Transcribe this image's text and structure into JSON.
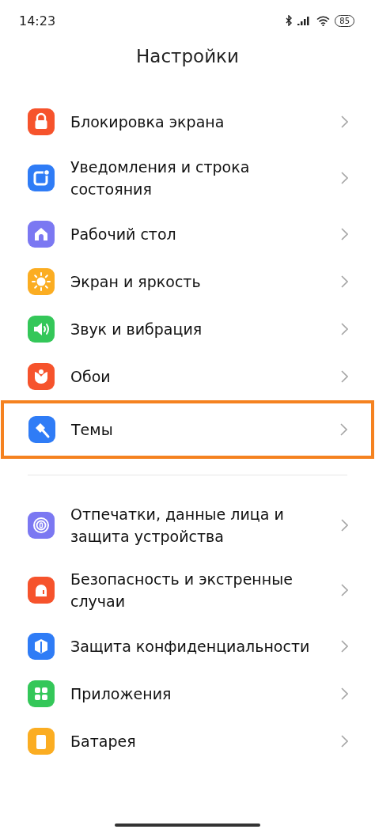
{
  "status_bar": {
    "time": "14:23",
    "battery": "85"
  },
  "title": "Настройки",
  "groups": [
    {
      "items": [
        {
          "label": "Блокировка экрана",
          "color": "#f6532c",
          "highlighted": false
        },
        {
          "label": "Уведомления и строка состояния",
          "color": "#2f7cf6",
          "highlighted": false
        },
        {
          "label": "Рабочий стол",
          "color": "#7b78f2",
          "highlighted": false
        },
        {
          "label": "Экран и яркость",
          "color": "#fbad22",
          "highlighted": false
        },
        {
          "label": "Звук и вибрация",
          "color": "#34c759",
          "highlighted": false
        },
        {
          "label": "Обои",
          "color": "#f6532c",
          "highlighted": false
        },
        {
          "label": "Темы",
          "color": "#2f7cf6",
          "highlighted": true
        }
      ]
    },
    {
      "items": [
        {
          "label": "Отпечатки, данные лица и защита устройства",
          "color": "#7b78f2",
          "highlighted": false
        },
        {
          "label": "Безопасность и экстренные случаи",
          "color": "#f6532c",
          "highlighted": false
        },
        {
          "label": "Защита конфиденциальности",
          "color": "#2f7cf6",
          "highlighted": false
        },
        {
          "label": "Приложения",
          "color": "#34c759",
          "highlighted": false
        },
        {
          "label": "Батарея",
          "color": "#fbad22",
          "highlighted": false
        }
      ]
    }
  ]
}
